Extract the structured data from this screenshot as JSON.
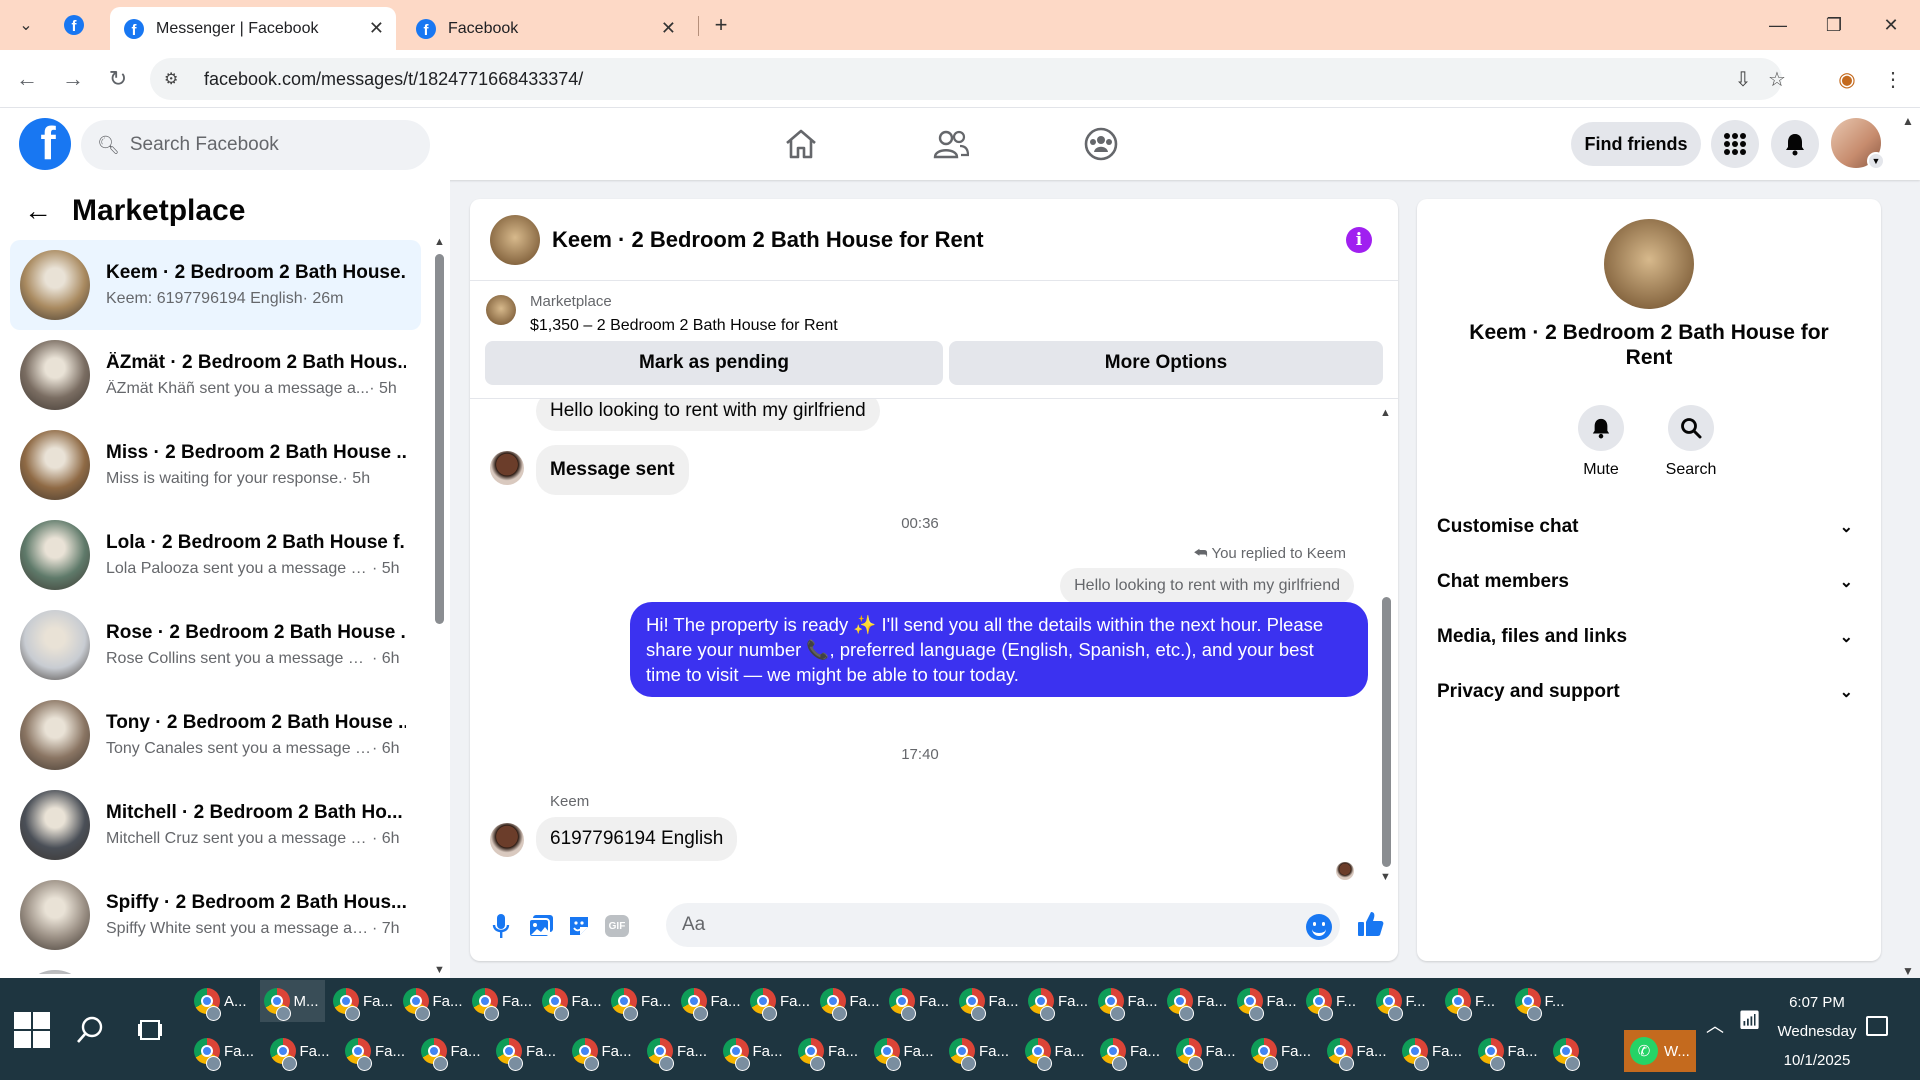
{
  "browser": {
    "tabs": [
      {
        "title": "Messenger | Facebook",
        "active": true
      },
      {
        "title": "Facebook",
        "active": false
      }
    ],
    "url": "facebook.com/messages/t/1824771668433374/"
  },
  "fb_header": {
    "search_placeholder": "Search Facebook",
    "find_friends": "Find friends"
  },
  "sidebar": {
    "title": "Marketplace",
    "conversations": [
      {
        "name": "Keem · 2 Bedroom 2 Bath House...",
        "preview": "Keem: 6197796194 English",
        "time": "· 26m",
        "selected": true,
        "color": "#a98a60"
      },
      {
        "name": "ÄZmät · 2 Bedroom 2 Bath Hous...",
        "preview": "ÄZmät Khäñ sent you a message a...",
        "time": "· 5h",
        "selected": false,
        "color": "#7a6d62"
      },
      {
        "name": "Miss · 2 Bedroom 2 Bath House ...",
        "preview": "Miss is waiting for your response.",
        "time": "· 5h",
        "selected": false,
        "color": "#8f6a45"
      },
      {
        "name": "Lola · 2 Bedroom 2 Bath House f...",
        "preview": "Lola Palooza sent you a message a...",
        "time": "· 5h",
        "selected": false,
        "color": "#5f7a6a"
      },
      {
        "name": "Rose · 2 Bedroom 2 Bath House ...",
        "preview": "Rose Collins sent you a message ab...",
        "time": "· 6h",
        "selected": false,
        "color": "#c8ccd2"
      },
      {
        "name": "Tony · 2 Bedroom 2 Bath House ...",
        "preview": "Tony Canales sent you a message a...",
        "time": "· 6h",
        "selected": false,
        "color": "#8a7563"
      },
      {
        "name": "Mitchell · 2 Bedroom 2 Bath Ho...",
        "preview": "Mitchell Cruz sent you a message a...",
        "time": "· 6h",
        "selected": false,
        "color": "#4a4f57"
      },
      {
        "name": "Spiffy · 2 Bedroom 2 Bath Hous...",
        "preview": "Spiffy White sent you a message ab...",
        "time": "· 7h",
        "selected": false,
        "color": "#9a8f84"
      },
      {
        "name": "",
        "preview": "",
        "time": "",
        "selected": false,
        "color": "#b0b3b8"
      }
    ]
  },
  "chat": {
    "title": "Keem · 2 Bedroom 2 Bath House for Rent",
    "marketplace_label": "Marketplace",
    "listing": "$1,350 – 2 Bedroom 2 Bath House for Rent",
    "mark_pending": "Mark as pending",
    "more_options": "More Options",
    "msg_in_1": "Hello looking to rent with my girlfriend",
    "msg_in_2": "Message sent",
    "time_1": "00:36",
    "reply_label": "You replied to Keem",
    "reply_quote": "Hello looking to rent with my girlfriend",
    "msg_out": "Hi! The property is ready ✨ I'll send you all the details within the next hour. Please share your number 📞, preferred language (English, Spanish, etc.), and your best time to visit — we might be able to tour today.",
    "time_2": "17:40",
    "sender_name": "Keem",
    "msg_in_3": "6197796194 English",
    "input_placeholder": "Aa"
  },
  "info_panel": {
    "name": "Keem · 2 Bedroom 2 Bath House for Rent",
    "mute": "Mute",
    "search": "Search",
    "sections": [
      "Customise chat",
      "Chat members",
      "Media, files and links",
      "Privacy and support"
    ]
  },
  "taskbar": {
    "row1": [
      "A...",
      "M...",
      "Fa...",
      "Fa...",
      "Fa...",
      "Fa...",
      "Fa...",
      "Fa...",
      "Fa...",
      "Fa...",
      "Fa...",
      "Fa...",
      "Fa...",
      "Fa...",
      "Fa...",
      "Fa...",
      "F...",
      "F...",
      "F...",
      "F..."
    ],
    "row2": [
      "Fa...",
      "Fa...",
      "Fa...",
      "Fa...",
      "Fa...",
      "Fa...",
      "Fa...",
      "Fa...",
      "Fa...",
      "Fa...",
      "Fa...",
      "Fa...",
      "Fa...",
      "Fa...",
      "Fa...",
      "Fa...",
      "Fa...",
      "Fa...",
      ""
    ],
    "whatsapp": "W...",
    "time": "6:07 PM",
    "day": "Wednesday",
    "date": "10/1/2025"
  }
}
